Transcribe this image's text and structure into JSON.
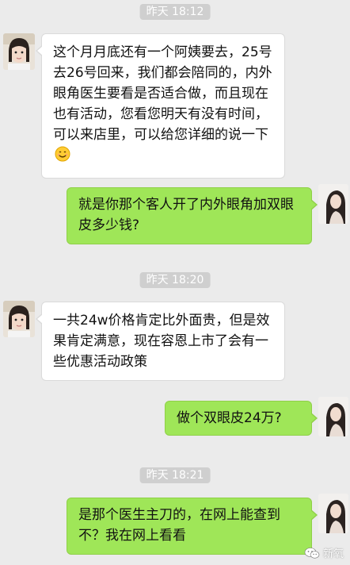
{
  "messages": [
    {
      "timestamp": "昨天 18:12"
    },
    {
      "incoming_1": "这个月月底还有一个阿姨要去，25号去26号回来，我们都会陪同的，内外眼角医生要看是否适合做，而且现在也有活动，您看您明天有没有时间，可以来店里，可以给您详细的说一下"
    },
    {
      "outgoing_1": "就是你那个客人开了内外眼角加双眼皮多少钱?"
    },
    {
      "timestamp": "昨天 18:20"
    },
    {
      "incoming_2": "一共24w价格肯定比外面贵，但是效果肯定满意，现在容恩上市了会有一些优惠活动政策"
    },
    {
      "outgoing_2": "做个双眼皮24万?"
    },
    {
      "timestamp": "昨天 18:21"
    },
    {
      "outgoing_3": "是那个医生主刀的，在网上能查到不？我在网上看看"
    }
  ],
  "chat": {
    "ts1": "昨天 18:12",
    "ts2": "昨天 18:20",
    "ts3": "昨天 18:21",
    "msg1": "这个月月底还有一个阿姨要去，25号去26号回来，我们都会陪同的，内外眼角医生要看是否适合做，而且现在也有活动，您看您明天有没有时间，可以来店里，可以给您详细的说一下",
    "msg2": "就是你那个客人开了内外眼角加双眼皮多少钱?",
    "msg3": "一共24w价格肯定比外面贵，但是效果肯定满意，现在容恩上市了会有一些优惠活动政策",
    "msg4": "做个双眼皮24万?",
    "msg5": "是那个医生主刀的，在网上能查到不？我在网上看看"
  },
  "icons": {
    "smile_emoji": "smiling-face-emoji",
    "watermark_logo": "wechat-logo"
  },
  "watermark": {
    "text": "新氧"
  },
  "colors": {
    "background": "#ebebeb",
    "incoming_bubble": "#ffffff",
    "outgoing_bubble": "#9fe658",
    "timestamp_bg": "#cfcfcf"
  }
}
